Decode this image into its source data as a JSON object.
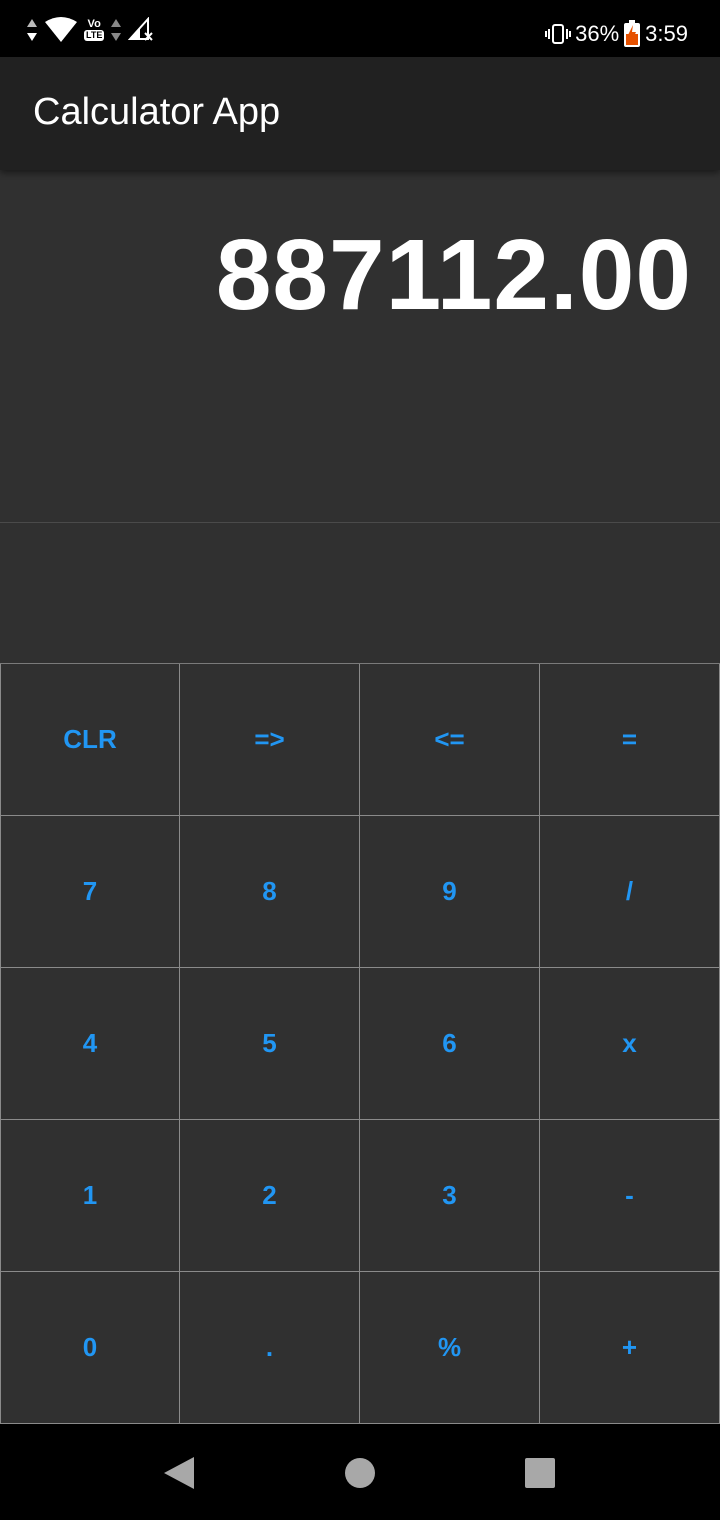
{
  "status_bar": {
    "volte_top": "Vo",
    "volte_bottom": "LTE",
    "battery_percent": "36%",
    "time": "3:59",
    "icons": [
      "data-arrows-icon",
      "wifi-icon",
      "volte-icon",
      "signal-icon",
      "vibrate-icon",
      "battery-charging-icon"
    ]
  },
  "app_bar": {
    "title": "Calculator App"
  },
  "display": {
    "value": "887112.00",
    "expression": ""
  },
  "keypad": {
    "rows": [
      [
        "CLR",
        "=>",
        "<=",
        "="
      ],
      [
        "7",
        "8",
        "9",
        "/"
      ],
      [
        "4",
        "5",
        "6",
        "x"
      ],
      [
        "1",
        "2",
        "3",
        "-"
      ],
      [
        "0",
        ".",
        "%",
        "+"
      ]
    ]
  },
  "navigation": {
    "icons": [
      "back-icon",
      "home-icon",
      "recents-icon"
    ]
  },
  "colors": {
    "background": "#303030",
    "app_bar": "#212121",
    "key_text": "#2196f3",
    "display_text": "#ffffff"
  }
}
